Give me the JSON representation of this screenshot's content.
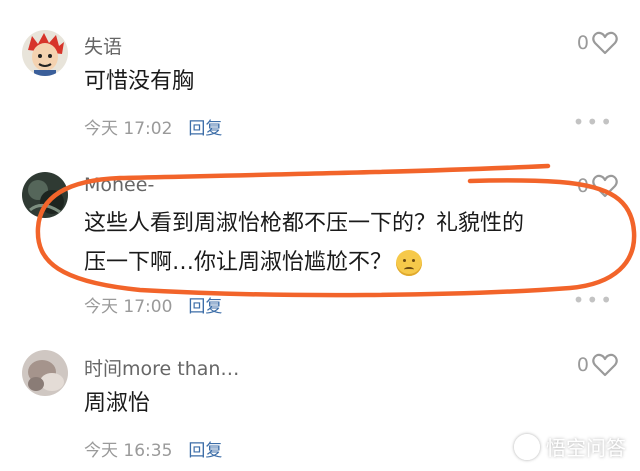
{
  "comments": [
    {
      "username": "失语",
      "content": "可惜没有胸",
      "time": "今天 17:02",
      "reply_label": "回复",
      "likes": "0",
      "avatar": "cartoon-face-avatar"
    },
    {
      "username": "Monee-",
      "content_line1": "这些人看到周淑怡枪都不压一下的？礼貌性的",
      "content_line2": "压一下啊…你让周淑怡尴尬不？",
      "time": "今天 17:00",
      "reply_label": "回复",
      "likes": "0",
      "avatar": "dark-photo-avatar",
      "emoji": "worried-face-emoji"
    },
    {
      "username": "时间more than…",
      "content": "周淑怡",
      "time": "今天 16:35",
      "reply_label": "回复",
      "likes": "0",
      "avatar": "blurry-photo-avatar"
    }
  ],
  "more_icon": "ellipsis-icon",
  "like_icon": "heart-outline-icon",
  "annotation_color": "#f2642a",
  "accent_color": "#3d6ea8",
  "watermark": {
    "text": "悟空问答",
    "logo": "wukong-logo"
  }
}
